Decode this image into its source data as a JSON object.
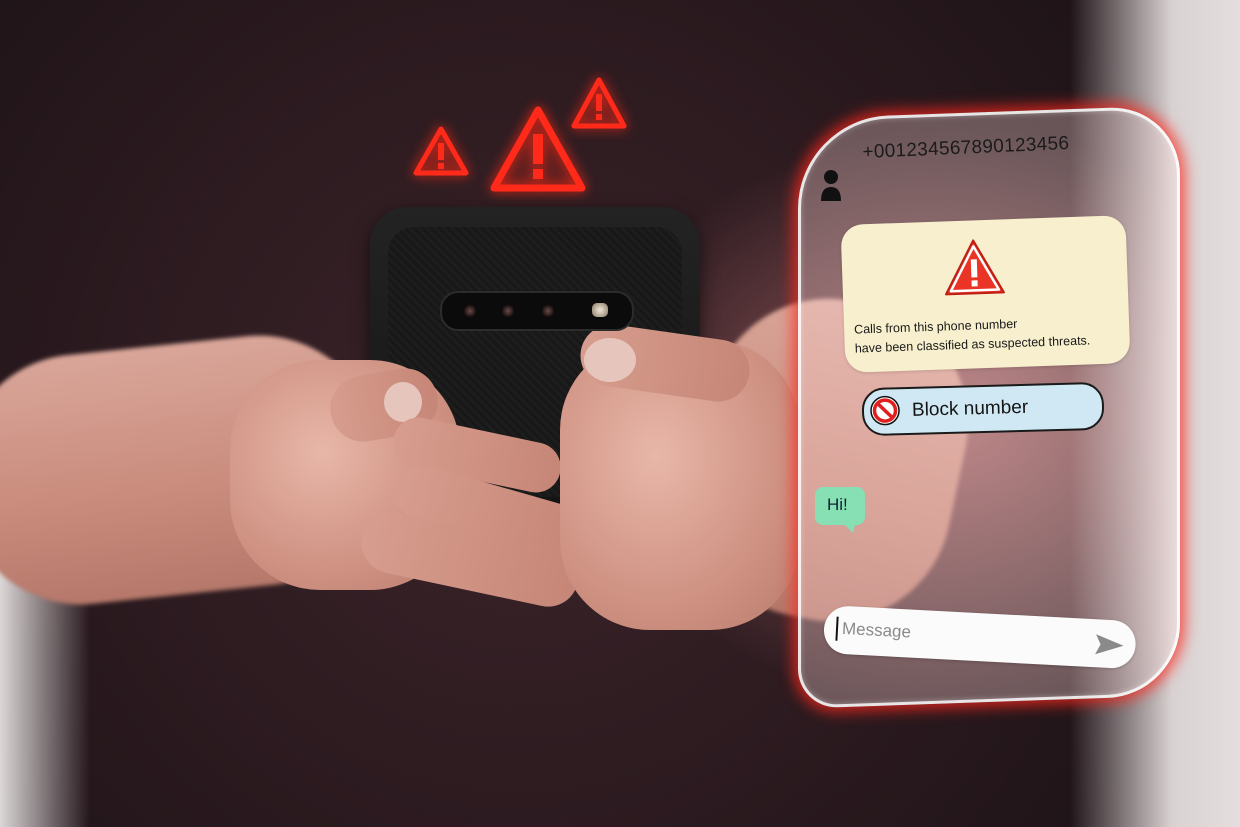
{
  "contact": {
    "icon": "person-icon",
    "phone_number": "+001234567890123456"
  },
  "alert": {
    "icon": "warning-triangle-icon",
    "line1": "Calls from this phone number",
    "line2": "have been classified as suspected threats."
  },
  "block_button": {
    "icon": "block-circle-icon",
    "label": "Block number"
  },
  "chat": {
    "incoming_message": "Hi!"
  },
  "composer": {
    "placeholder": "Message",
    "send_icon": "send-arrow-icon"
  },
  "floating_warnings": {
    "icon": "warning-triangle-icon",
    "color": "#ff2a1a",
    "count": 3
  },
  "colors": {
    "alert_background": "#f7efcd",
    "block_button_background": "#cfe8f3",
    "message_bubble": "#86e0b4",
    "glow_red": "#ff2a1a"
  }
}
